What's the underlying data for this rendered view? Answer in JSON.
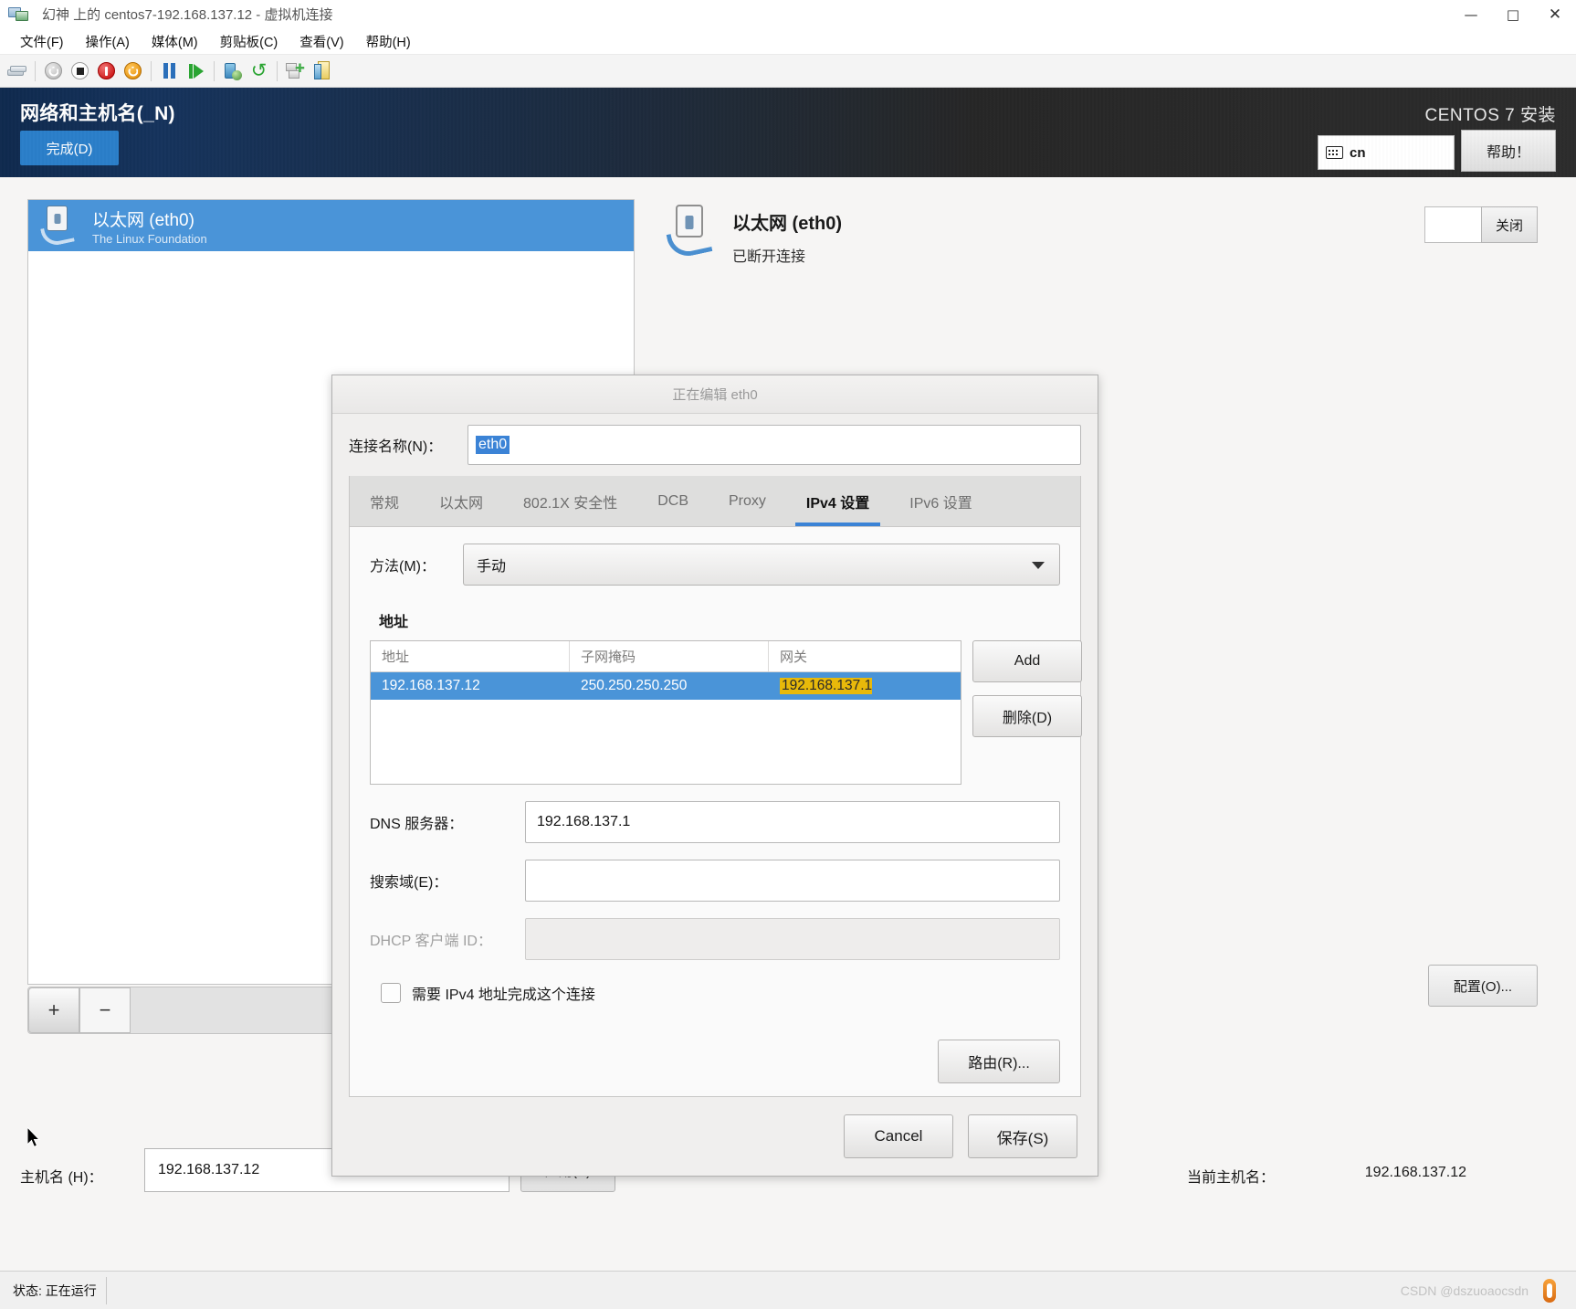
{
  "window": {
    "title": "幻神 上的 centos7-192.168.137.12 - 虚拟机连接",
    "minimize": "—",
    "maximize": "□",
    "close": "✕"
  },
  "menubar": {
    "items": [
      {
        "label": "文件(F)"
      },
      {
        "label": "操作(A)"
      },
      {
        "label": "媒体(M)"
      },
      {
        "label": "剪贴板(C)"
      },
      {
        "label": "查看(V)"
      },
      {
        "label": "帮助(H)"
      }
    ]
  },
  "toolbar": {
    "items": [
      {
        "name": "checkpoints-icon",
        "title": "检查点"
      },
      {
        "name": "power-off-icon",
        "title": "关机"
      },
      {
        "name": "shutdown-icon",
        "title": "停止"
      },
      {
        "name": "turn-off-icon",
        "title": "关闭电源"
      },
      {
        "name": "start-icon",
        "title": "启动"
      },
      {
        "name": "pause-icon",
        "title": "暂停"
      },
      {
        "name": "resume-icon",
        "title": "继续"
      },
      {
        "name": "checkpoint-create-icon",
        "title": "创建检查点"
      },
      {
        "name": "revert-icon",
        "title": "还原"
      },
      {
        "name": "network-add-icon",
        "title": "网络"
      },
      {
        "name": "enhanced-session-icon",
        "title": "增强会话"
      }
    ]
  },
  "installer": {
    "page_title": "网络和主机名(_N)",
    "done_label": "完成(D)",
    "brand": "CENTOS 7 安装",
    "keyboard_layout": "cn",
    "help_label": "帮助！"
  },
  "devices": {
    "items": [
      {
        "name": "以太网 (eth0)",
        "vendor": "The Linux Foundation",
        "selected": true
      }
    ],
    "add_label": "+",
    "remove_label": "−"
  },
  "detail": {
    "name": "以太网 (eth0)",
    "state": "已断开连接",
    "toggle_label": "关闭",
    "configure_label": "配置(O)..."
  },
  "hostname": {
    "label": "主机名 (H)：",
    "value": "192.168.137.12",
    "apply_label": "应用(A)",
    "current_label": "当前主机名：",
    "current_value": "192.168.137.12"
  },
  "dialog": {
    "title": "正在编辑 eth0",
    "connection_name_label": "连接名称(N)：",
    "connection_name_value": "eth0",
    "tabs": [
      {
        "label": "常规",
        "active": false
      },
      {
        "label": "以太网",
        "active": false
      },
      {
        "label": "802.1X 安全性",
        "active": false
      },
      {
        "label": "DCB",
        "active": false
      },
      {
        "label": "Proxy",
        "active": false
      },
      {
        "label": "IPv4 设置",
        "active": true
      },
      {
        "label": "IPv6 设置",
        "active": false
      }
    ],
    "method_label": "方法(M)：",
    "method_value": "手动",
    "addresses_title": "地址",
    "addr_columns": [
      "地址",
      "子网掩码",
      "网关"
    ],
    "addr_rows": [
      {
        "address": "192.168.137.12",
        "netmask": "250.250.250.250",
        "gateway": "192.168.137.1",
        "editing_cell": "gateway"
      }
    ],
    "add_label": "Add",
    "delete_label": "删除(D)",
    "dns_label": "DNS 服务器：",
    "dns_value": "192.168.137.1",
    "search_label": "搜索域(E)：",
    "search_value": "",
    "dhcp_label": "DHCP 客户端 ID：",
    "dhcp_value": "",
    "require_ipv4_label": "需要 IPv4 地址完成这个连接",
    "require_ipv4_checked": false,
    "routes_label": "路由(R)...",
    "cancel_label": "Cancel",
    "save_label": "保存(S)"
  },
  "statusbar": {
    "status": "状态: 正在运行",
    "watermark": "CSDN @dszuoaocsdn"
  },
  "colors": {
    "accent_blue": "#2b7ec9",
    "selection_blue": "#4a94d8",
    "edit_yellow": "#e8b90a",
    "header_dark": "#262626"
  }
}
